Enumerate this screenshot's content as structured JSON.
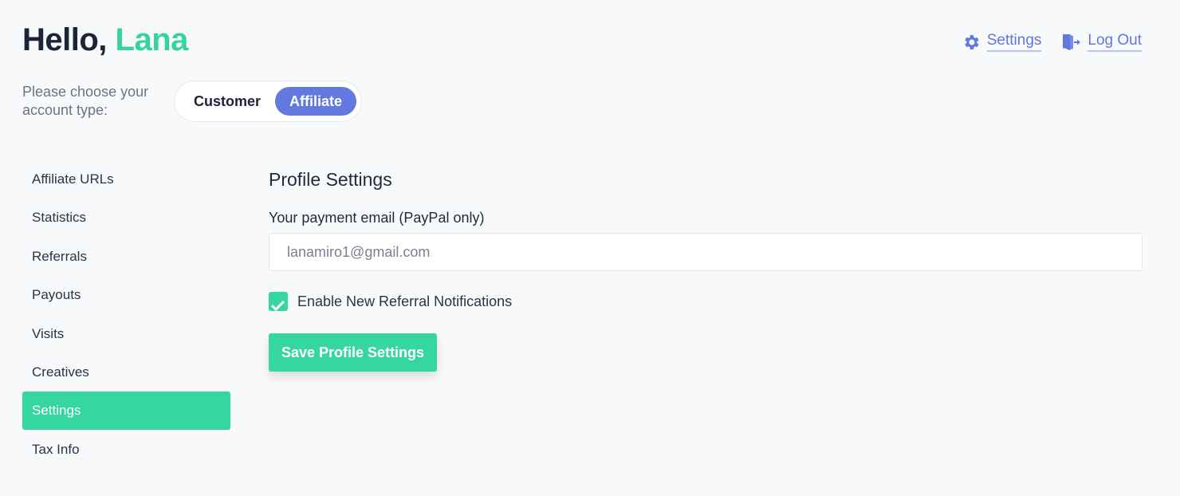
{
  "header": {
    "greeting_prefix": "Hello,",
    "user_name": "Lana",
    "links": {
      "settings_label": "Settings",
      "settings_icon": "gear-icon",
      "logout_label": "Log Out",
      "logout_icon": "door-exit-icon"
    }
  },
  "account_type": {
    "label": "Please choose your account type:",
    "options": [
      "Customer",
      "Affiliate"
    ],
    "selected": "Affiliate"
  },
  "sidebar": {
    "items": [
      {
        "label": "Affiliate URLs",
        "active": false
      },
      {
        "label": "Statistics",
        "active": false
      },
      {
        "label": "Referrals",
        "active": false
      },
      {
        "label": "Payouts",
        "active": false
      },
      {
        "label": "Visits",
        "active": false
      },
      {
        "label": "Creatives",
        "active": false
      },
      {
        "label": "Settings",
        "active": true
      },
      {
        "label": "Tax Info",
        "active": false
      }
    ]
  },
  "profile": {
    "title": "Profile Settings",
    "email_label": "Your payment email (PayPal only)",
    "email_value": "lanamiro1@gmail.com",
    "notifications_label": "Enable New Referral Notifications",
    "notifications_checked": true,
    "save_label": "Save Profile Settings"
  },
  "colors": {
    "accent_green": "#35d69f",
    "accent_blue": "#6279e0",
    "text_dark": "#1a2536"
  }
}
